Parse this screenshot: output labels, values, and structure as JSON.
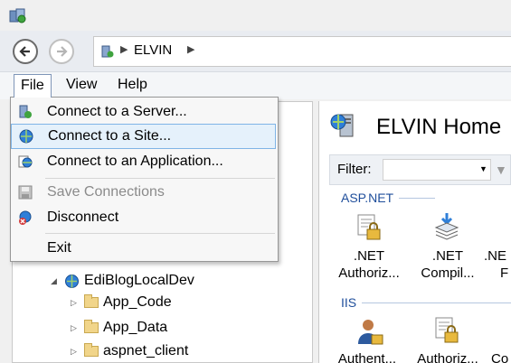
{
  "address": {
    "crumbs": [
      "ELVIN"
    ]
  },
  "menubar": [
    {
      "label": "File",
      "active": true
    },
    {
      "label": "View"
    },
    {
      "label": "Help"
    }
  ],
  "file_menu": {
    "items": [
      {
        "label": "Connect to a Server...",
        "icon": "server-connect-icon",
        "enabled": true
      },
      {
        "label": "Connect to a Site...",
        "icon": "globe-icon",
        "enabled": true,
        "highlighted": true
      },
      {
        "label": "Connect to an Application...",
        "icon": "application-connect-icon",
        "enabled": true
      },
      {
        "label": "Save Connections",
        "icon": "floppy-disk-icon",
        "enabled": false
      },
      {
        "label": "Disconnect",
        "icon": "disconnect-icon",
        "enabled": true
      },
      {
        "label": "Exit",
        "enabled": true
      }
    ]
  },
  "tree": [
    {
      "label": "EdiBlogLocalDev",
      "icon": "site-globe-icon",
      "expanded": true
    },
    {
      "label": "App_Code",
      "icon": "folder-icon"
    },
    {
      "label": "App_Data",
      "icon": "folder-icon"
    },
    {
      "label": "aspnet_client",
      "icon": "folder-icon"
    }
  ],
  "home": {
    "title": "ELVIN Home",
    "filter_label": "Filter:",
    "groups": [
      {
        "name": "ASP.NET",
        "features": [
          {
            "label": ".NET Authoriz...",
            "line1": ".NET",
            "line2": "Authoriz..."
          },
          {
            "label": ".NET Compil...",
            "line1": ".NET",
            "line2": "Compil..."
          },
          {
            "label": ".NE F",
            "line1": ".NE",
            "line2": "F"
          }
        ]
      },
      {
        "name": "IIS",
        "features": [
          {
            "label": "Authent...",
            "line1": "Authent..."
          },
          {
            "label": "Authoriz...",
            "line1": "Authoriz..."
          },
          {
            "label": "Co",
            "line1": "Co"
          }
        ]
      }
    ]
  },
  "colors": {
    "highlight": "#e5f1fb",
    "highlight_border": "#7fb4e6",
    "group_header": "#1f4e9b"
  }
}
